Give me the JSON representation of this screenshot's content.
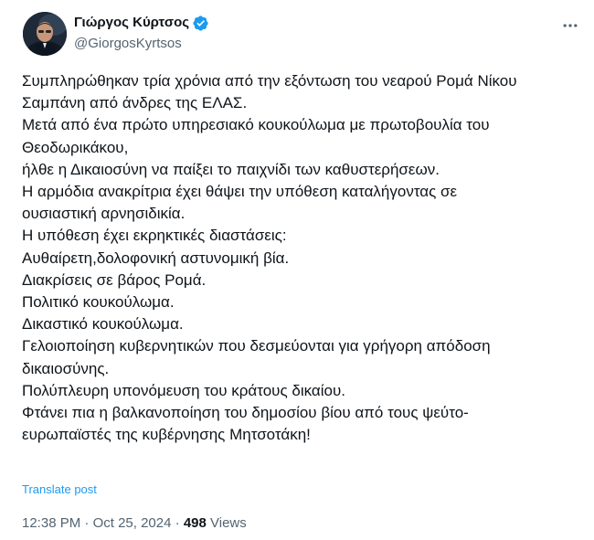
{
  "author": {
    "display_name": "Γιώργος Κύρτσος",
    "handle": "@GiorgosKyrtsos",
    "verified": true,
    "avatar": "profile-photo"
  },
  "post": {
    "lines": [
      "Συμπληρώθηκαν τρία χρόνια από την εξόντωση του νεαρού Ρομά Νίκου",
      "Σαμπάνη από άνδρες της ΕΛΑΣ.",
      "Μετά από ένα πρώτο υπηρεσιακό κουκούλωμα με πρωτοβουλία του",
      "Θεοδωρικάκου,",
      "ήλθε η Δικαιοσύνη να παίξει το παιχνίδι των καθυστερήσεων.",
      "Η αρμόδια ανακρίτρια έχει θάψει την υπόθεση καταλήγοντας σε",
      "ουσιαστική αρνησιδικία.",
      "Η υπόθεση έχει εκρηκτικές διαστάσεις:",
      "Αυθαίρετη,δολοφονική αστυνομική βία.",
      "Διακρίσεις σε βάρος Ρομά.",
      "Πολιτικό κουκούλωμα.",
      "Δικαστικό κουκούλωμα.",
      "Γελοιοποίηση κυβερνητικών που δεσμεύονται για γρήγορη απόδοση",
      "δικαιοσύνης.",
      "Πολύπλευρη υπονόμευση του κράτους δικαίου.",
      "Φτάνει πια η βαλκανοποίηση του δημοσίου βίου από τους ψεύτο-",
      "ευρωπαϊστές της κυβέρνησης Μητσοτάκη!"
    ],
    "translate_label": "Translate post",
    "time": "12:38 PM",
    "separator": "·",
    "date": "Oct 25, 2024",
    "views_count": "498",
    "views_label": "Views"
  },
  "icons": {
    "verified": "verified-badge-icon",
    "more": "more-options-icon"
  },
  "colors": {
    "text": "#0f1419",
    "secondary": "#536471",
    "accent": "#1d9bf0"
  }
}
